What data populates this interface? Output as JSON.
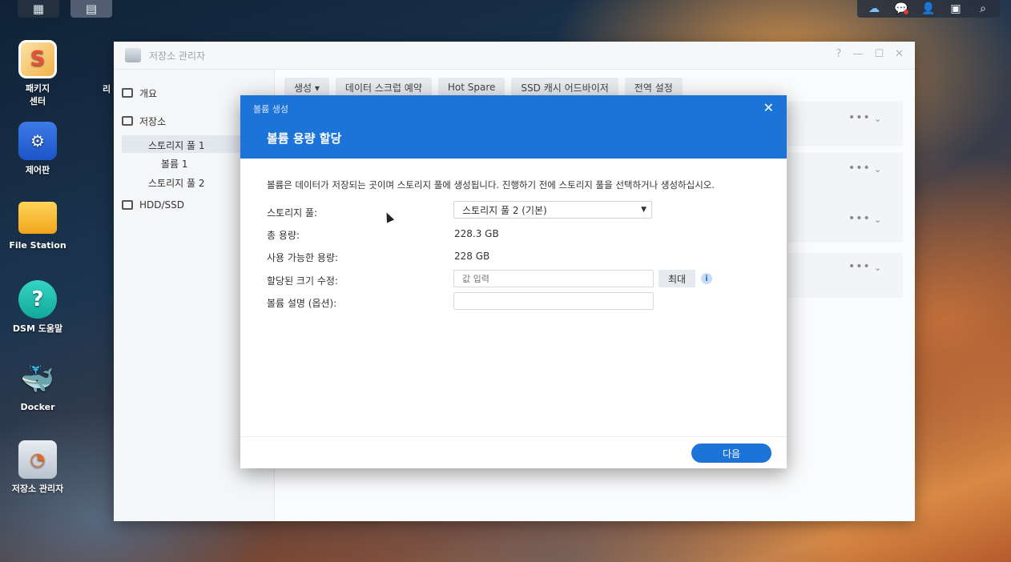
{
  "desktop": {
    "icons": [
      {
        "label": "패키지\n센터",
        "glyph": "S"
      },
      {
        "label": "제어판",
        "glyph": "⚙"
      },
      {
        "label": "File Station",
        "glyph": ""
      },
      {
        "label": "DSM 도움말",
        "glyph": "?"
      },
      {
        "label": "Docker",
        "glyph": "🐳"
      },
      {
        "label": "저장소 관리자",
        "glyph": "◔"
      }
    ],
    "partial_label": "리"
  },
  "taskbar": {
    "left_icons": [
      "grid-icon",
      "storage-manager-task-icon"
    ],
    "right_icons": [
      "cloud-sync-icon",
      "notification-icon",
      "user-icon",
      "widgets-icon",
      "search-icon"
    ]
  },
  "main_window": {
    "title": "저장소 관리자",
    "controls": [
      "?",
      "—",
      "☐",
      "✕"
    ],
    "sidebar": {
      "overview": "개요",
      "storage": "저장소",
      "pool1": "스토리지 풀 1",
      "volume1": "볼륨 1",
      "pool2": "스토리지 풀 2",
      "hdd": "HDD/SSD"
    },
    "toolbar": {
      "create": "생성 ▾",
      "scrub": "데이터 스크럽 예약",
      "hotspare": "Hot Spare",
      "ssd": "SSD 캐시 어드바이저",
      "global": "전역 설정"
    }
  },
  "modal": {
    "window_title": "볼륨 생성",
    "heading": "볼륨 용량 할당",
    "description": "볼륨은 데이터가 저장되는 곳이며 스토리지 풀에 생성됩니다. 진행하기 전에 스토리지 풀을 선택하거나 생성하십시오.",
    "fields": {
      "pool_label": "스토리지 풀:",
      "pool_value": "스토리지 풀 2 (기본)",
      "total_label": "총 용량:",
      "total_value": "228.3 GB",
      "avail_label": "사용 가능한 용량:",
      "avail_value": "228 GB",
      "alloc_label": "할당된 크기 수정:",
      "alloc_placeholder": "값 입력",
      "max_button": "최대",
      "desc_label": "볼륨 설명 (옵션):",
      "desc_value": ""
    },
    "next_button": "다음"
  },
  "colors": {
    "accent": "#1c73d8"
  }
}
